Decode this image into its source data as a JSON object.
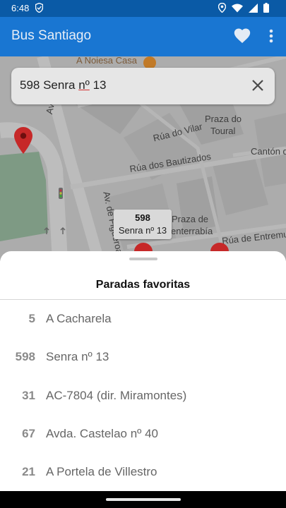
{
  "status_bar": {
    "time": "6:48",
    "icons": [
      "shield-icon",
      "location-icon",
      "wifi-icon",
      "signal-icon",
      "battery-icon"
    ]
  },
  "app_bar": {
    "title": "Bus Santiago",
    "favorite_icon": "heart-icon",
    "menu_icon": "more-vert-icon",
    "color": "#1976d2"
  },
  "search": {
    "value_before": "598 Senra ",
    "value_underlined": "nº",
    "value_after": " 13",
    "clear_icon": "close-icon"
  },
  "map": {
    "labels": {
      "poi": "A Noiesa Casa",
      "street_av_de": "Av. de",
      "street_vilar": "Rúa do Vilar",
      "square_toural_1": "Praza do",
      "square_toural_2": "Toural",
      "canton": "Cantón d",
      "street_bautizados": "Rúa dos Bautizados",
      "street_figueroa": "Av. de Figueroa",
      "square_praza_de": "Praza de",
      "square_enterrabia": "enterrabía",
      "street_entremu": "Rúa de Entremu"
    },
    "stop_popup": {
      "code": "598",
      "name": "Senra nº 13"
    },
    "pin_color": "#d32f2f"
  },
  "favorites": {
    "title": "Paradas favoritas",
    "items": [
      {
        "code": "5",
        "name": "A Cacharela"
      },
      {
        "code": "598",
        "name": "Senra nº 13"
      },
      {
        "code": "31",
        "name": "AC-7804 (dir. Miramontes)"
      },
      {
        "code": "67",
        "name": "Avda. Castelao nº 40"
      },
      {
        "code": "21",
        "name": "A Portela de Villestro"
      }
    ]
  }
}
